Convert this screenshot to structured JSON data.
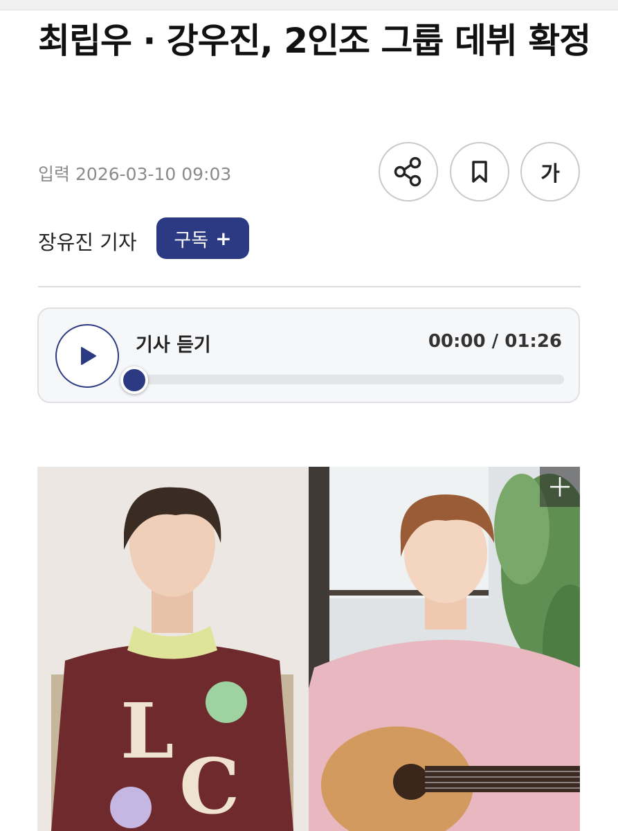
{
  "article": {
    "headline": "최립우 · 강우진, 2인조 그룹 데뷔 확정",
    "date_label": "입력",
    "date": "2026-03-10 09:03",
    "reporter": "장유진 기자",
    "subscribe_label": "구독",
    "subscribe_icon": "+"
  },
  "actions": {
    "share_icon": "share-icon",
    "bookmark_icon": "bookmark-icon",
    "font_size_label": "가"
  },
  "audio": {
    "title": "기사 듣기",
    "current_time": "00:00",
    "separator": "/",
    "duration": "01:26",
    "progress_fraction": 0.0
  },
  "photo": {
    "expand_icon": "plus-icon"
  },
  "colors": {
    "accent": "#2b3a82",
    "border": "#c9c9c9",
    "muted_text": "#8a8a8a"
  }
}
